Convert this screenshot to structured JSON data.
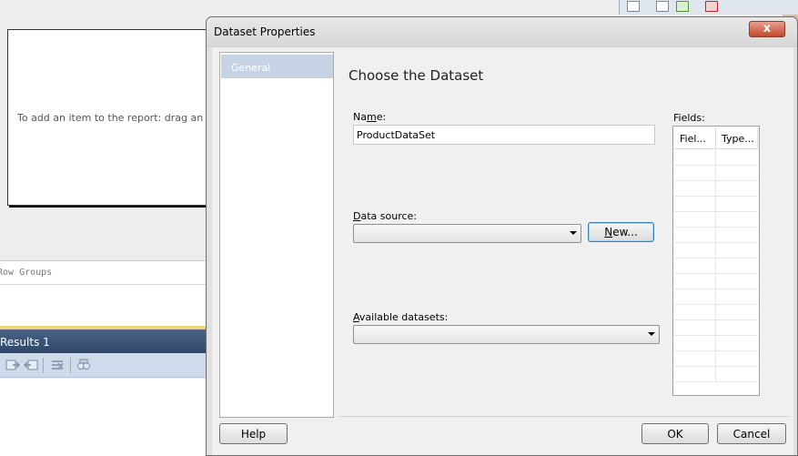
{
  "background": {
    "report_hint": "To add an item to the report: drag an item",
    "row_groups_label": "Row Groups",
    "results_title": "Results 1"
  },
  "dialog": {
    "title": "Dataset Properties",
    "close_label": "x",
    "nav": [
      {
        "label": "General",
        "selected": true
      }
    ],
    "heading": "Choose the Dataset",
    "name_label_pre": "Na",
    "name_label_ul": "m",
    "name_label_post": "e:",
    "name_value": "ProductDataSet",
    "data_source_label_ul": "D",
    "data_source_label_post": "ata source:",
    "data_source_value": "",
    "new_button_ul": "N",
    "new_button_post": "ew...",
    "available_datasets_label_ul": "A",
    "available_datasets_label_post": "vailable datasets:",
    "available_datasets_value": "",
    "fields_label": "Fields:",
    "fields_columns": [
      "Fiel...",
      "Type..."
    ],
    "help_button": "Help",
    "ok_button": "OK",
    "cancel_button": "Cancel"
  },
  "colors": {
    "nav_selected": "#c5d3e5",
    "results_header": "#2e4668",
    "close_button": "#c6472b"
  }
}
